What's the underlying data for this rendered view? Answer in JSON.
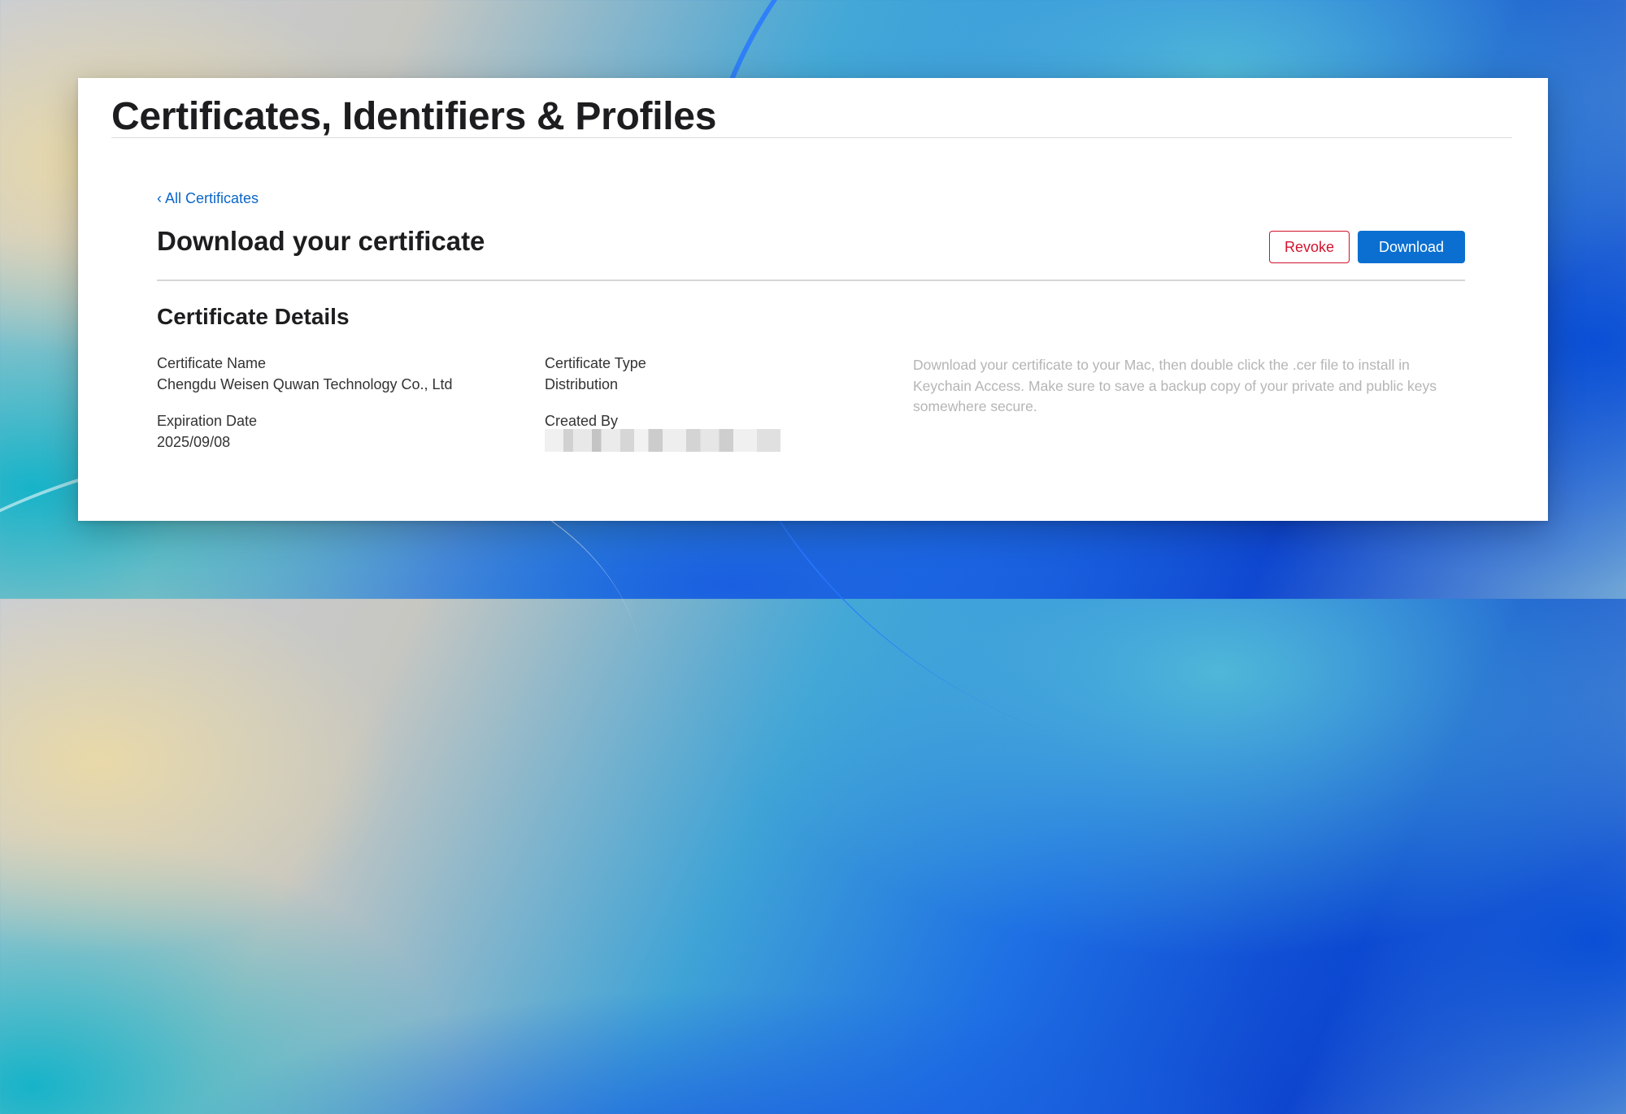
{
  "header": {
    "title": "Certificates, Identifiers & Profiles"
  },
  "nav": {
    "back_link": "‹ All Certificates"
  },
  "page": {
    "heading": "Download your certificate"
  },
  "actions": {
    "revoke_label": "Revoke",
    "download_label": "Download"
  },
  "details": {
    "title": "Certificate Details",
    "certificate_name_label": "Certificate Name",
    "certificate_name": "Chengdu Weisen Quwan Technology Co., Ltd",
    "certificate_type_label": "Certificate Type",
    "certificate_type": "Distribution",
    "expiration_date_label": "Expiration Date",
    "expiration_date": "2025/09/08",
    "created_by_label": "Created By"
  },
  "help": {
    "text": "Download your certificate to your Mac, then double click the .cer file to install in Keychain Access. Make sure to save a backup copy of your private and public keys somewhere secure."
  },
  "colors": {
    "link": "#0a66c9",
    "primary_button": "#0a6fd0",
    "destructive": "#d3122d"
  }
}
